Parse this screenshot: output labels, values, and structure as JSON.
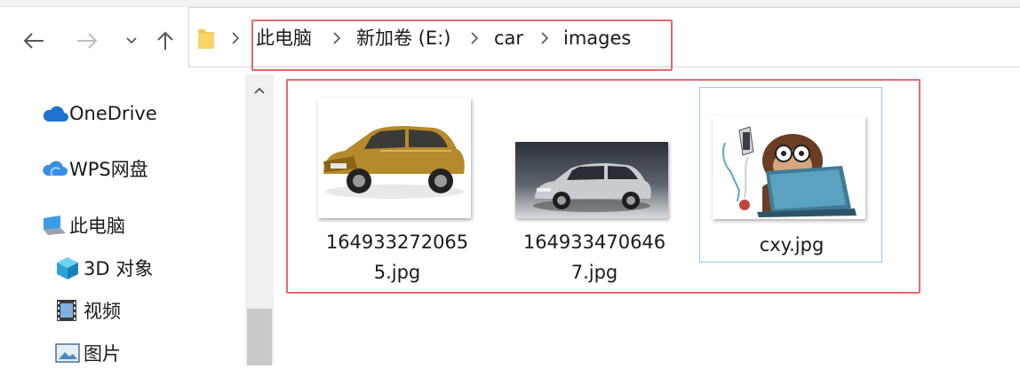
{
  "breadcrumb": {
    "items": [
      "此电脑",
      "新加卷 (E:)",
      "car",
      "images"
    ]
  },
  "sidebar": {
    "items": [
      {
        "label": "OneDrive",
        "icon": "cloud-icon"
      },
      {
        "label": "WPS网盘",
        "icon": "wps-cloud-icon"
      },
      {
        "label": "此电脑",
        "icon": "computer-icon"
      },
      {
        "label": "3D 对象",
        "icon": "3d-objects-icon"
      },
      {
        "label": "视频",
        "icon": "video-icon"
      },
      {
        "label": "图片",
        "icon": "pictures-icon"
      }
    ]
  },
  "files": [
    {
      "name_line1": "164933272065",
      "name_line2": "5.jpg",
      "thumb": "gold-suv-thumbnail"
    },
    {
      "name_line1": "164933470646",
      "name_line2": "7.jpg",
      "thumb": "silver-suv-thumbnail"
    },
    {
      "name_line1": "cxy.jpg",
      "name_line2": "",
      "thumb": "monkey-laptop-thumbnail",
      "selected": true
    }
  ],
  "colors": {
    "highlight": "#e5696f",
    "selection": "#9ac6ea",
    "accent": "#2b79d0"
  }
}
